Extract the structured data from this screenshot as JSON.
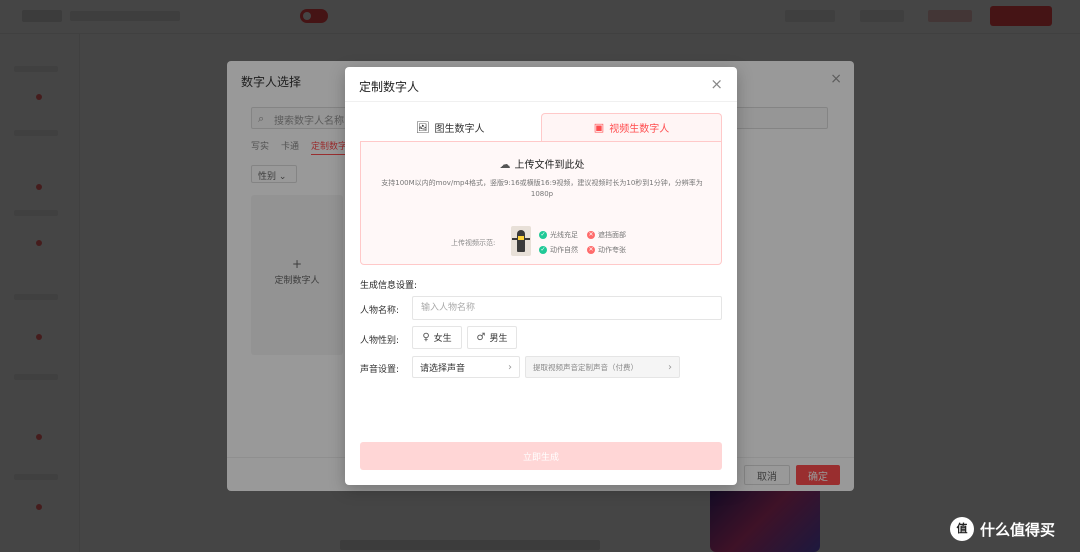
{
  "back_dialog": {
    "title": "数字人选择",
    "close": "×",
    "search_placeholder": "搜索数字人名称",
    "tabs": [
      "写实",
      "卡通",
      "定制数字人"
    ],
    "filter": "性别",
    "card_label": "定制数字人",
    "cancel": "取消",
    "confirm": "确定"
  },
  "dialog": {
    "title": "定制数字人",
    "close": "×",
    "tabs": [
      {
        "label": "图生数字人",
        "icon": "image-icon",
        "active": false
      },
      {
        "label": "视频生数字人",
        "icon": "video-icon",
        "active": true
      }
    ],
    "upload": {
      "title": "上传文件到此处",
      "description": "支持100M以内的mov/mp4格式，竖版9:16或横版16:9视频，建议视频时长为10秒到1分钟，分辨率为1080p",
      "example_label": "上传视频示范:",
      "rules": [
        {
          "text": "光线充足",
          "ok": true
        },
        {
          "text": "遮挡面部",
          "ok": false
        },
        {
          "text": "动作自然",
          "ok": true
        },
        {
          "text": "动作夸张",
          "ok": false
        }
      ]
    },
    "section_title": "生成信息设置:",
    "name_label": "人物名称:",
    "name_placeholder": "输入人物名称",
    "gender_label": "人物性别:",
    "gender_female": "女生",
    "gender_male": "男生",
    "voice_label": "声音设置:",
    "voice_select": "请选择声音",
    "voice_extract": "提取视频声音定制声音",
    "voice_extract_note": "（付费）",
    "generate": "立即生成"
  },
  "watermark": {
    "logo": "值",
    "text": "什么值得买"
  },
  "colors": {
    "accent": "#ff4d4f",
    "tab_bg": "#fff5f5",
    "tab_border": "#ffc9c9",
    "disabled_btn": "#ffd6d6"
  }
}
